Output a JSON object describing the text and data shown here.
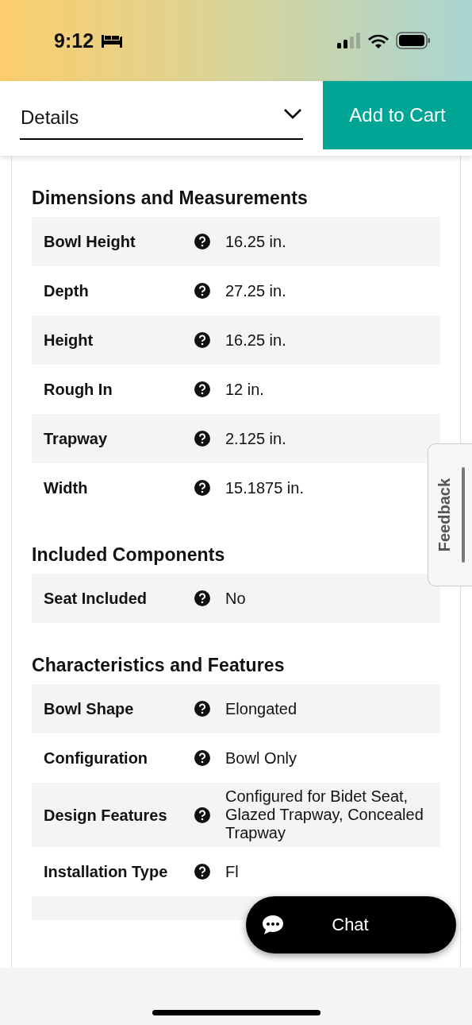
{
  "status_bar": {
    "time": "9:12"
  },
  "header": {
    "dropdown": {
      "value": "Details"
    },
    "cart_button": "Add to Cart"
  },
  "sections": [
    {
      "title": "Dimensions and Measurements",
      "rows": [
        {
          "label": "Bowl Height",
          "value": "16.25 in."
        },
        {
          "label": "Depth",
          "value": "27.25 in."
        },
        {
          "label": "Height",
          "value": "16.25 in."
        },
        {
          "label": "Rough In",
          "value": "12 in."
        },
        {
          "label": "Trapway",
          "value": "2.125 in."
        },
        {
          "label": "Width",
          "value": "15.1875 in."
        }
      ]
    },
    {
      "title": "Included Components",
      "rows": [
        {
          "label": "Seat Included",
          "value": "No"
        }
      ]
    },
    {
      "title": "Characteristics and Features",
      "rows": [
        {
          "label": "Bowl Shape",
          "value": "Elongated"
        },
        {
          "label": "Configuration",
          "value": "Bowl Only"
        },
        {
          "label": "Design Features",
          "value": "Configured for Bidet Seat, Glazed Trapway, Concealed Trapway"
        },
        {
          "label": "Installation Type",
          "value": "Fl"
        }
      ]
    }
  ],
  "feedback_tab": "Feedback",
  "chat_button": "Chat"
}
